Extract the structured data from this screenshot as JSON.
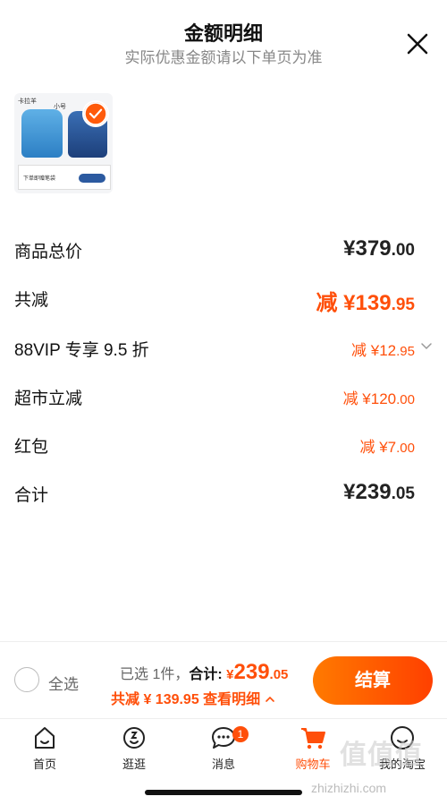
{
  "header": {
    "title": "金额明细",
    "subtitle": "实际优惠金额请以下单页为准"
  },
  "product": {
    "brand": "卡拉羊",
    "size": "小号",
    "gift_text": "下单即赠笔袋",
    "selected": true
  },
  "rows": {
    "total_price": {
      "label": "商品总价",
      "currency": "¥",
      "int": "379",
      "dec": ".00"
    },
    "total_discount": {
      "label": "共减",
      "prefix": "减 ¥",
      "int": "139",
      "dec": ".95"
    },
    "vip": {
      "label": "88VIP 专享 9.5 折",
      "prefix": "减 ¥",
      "int": "12",
      "dec": ".95"
    },
    "market": {
      "label": "超市立减",
      "prefix": "减 ¥",
      "int": "120",
      "dec": ".00"
    },
    "redpacket": {
      "label": "红包",
      "prefix": "减 ¥",
      "int": "7",
      "dec": ".00"
    },
    "sum": {
      "label": "合计",
      "currency": "¥",
      "int": "239",
      "dec": ".05"
    }
  },
  "bottom_bar": {
    "select_all": "全选",
    "selected_count": "已选 1件，",
    "sum_label": "合计:",
    "currency": "¥",
    "sum_int": "239",
    "sum_dec": ".05",
    "discount_text": "共减 ¥ 139.95  查看明细",
    "checkout": "结算"
  },
  "tabbar": {
    "items": [
      {
        "label": "首页",
        "icon": "home-icon"
      },
      {
        "label": "逛逛",
        "icon": "browse-icon"
      },
      {
        "label": "消息",
        "icon": "message-icon",
        "badge": "1"
      },
      {
        "label": "购物车",
        "icon": "cart-icon",
        "active": true
      },
      {
        "label": "我的淘宝",
        "icon": "profile-icon"
      }
    ]
  },
  "watermark": {
    "logo": "值值值",
    "url": "zhizhizhi.com"
  },
  "colors": {
    "accent": "#ff4f0a",
    "checkout_start": "#ff7a00",
    "checkout_end": "#ff4000"
  }
}
